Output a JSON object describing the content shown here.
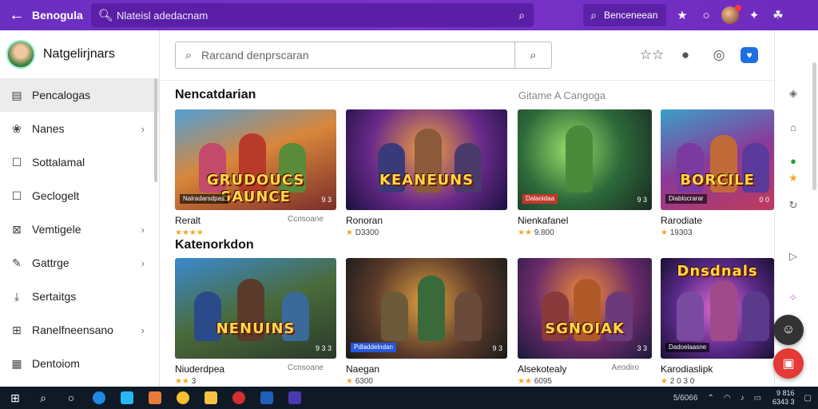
{
  "topbar": {
    "title": "Benogula",
    "search_text": "Nlateisl adedacnam",
    "pill_label": "Benceneean",
    "icons": [
      "back-arrow-icon",
      "search-icon",
      "star-icon",
      "shield-icon",
      "avatar",
      "settings-icon",
      "network-icon"
    ]
  },
  "sidebar": {
    "profile_name": "Natgelirjnars",
    "items": [
      {
        "label": "Pencalogas",
        "icon": "library-icon",
        "active": true
      },
      {
        "label": "Nanes",
        "icon": "tag-icon",
        "chevron": true
      },
      {
        "label": "Sottalamal",
        "icon": "square-icon"
      },
      {
        "label": "Geclogelt",
        "icon": "square-icon"
      },
      {
        "label": "Vemtigele",
        "icon": "image-icon",
        "chevron": true
      },
      {
        "label": "Gattrge",
        "icon": "edit-icon",
        "chevron": true
      },
      {
        "label": "Sertaitgs",
        "icon": "upload-icon"
      },
      {
        "label": "Ranelfneensano",
        "icon": "grid-icon",
        "chevron": true
      },
      {
        "label": "Dentoiom",
        "icon": "calendar-icon"
      }
    ]
  },
  "main": {
    "search_placeholder": "Rarcand denprscaran",
    "section1_title": "Nencatdarian",
    "section1_right": "Gitame A Cangoga",
    "section2_title": "Katenorkdon",
    "row1": [
      {
        "name": "Reralt",
        "meta": "Ccnsoane",
        "rating": "★★★★",
        "rating_text": "",
        "logo": "GRUDOUCS SAUNCE",
        "badge": "Nalradarsdpas",
        "size": "9 3"
      },
      {
        "name": "Ronoran",
        "meta": "",
        "rating": "★",
        "rating_text": "D3300",
        "logo": "KEANEUNS",
        "badge": "",
        "size": ""
      },
      {
        "name": "Nienkafanel",
        "meta": "",
        "rating": "★★",
        "rating_text": "9.800",
        "logo": "",
        "badge": "Dalaoidaa",
        "size": "9 3"
      },
      {
        "name": "Rarodiate",
        "meta": "",
        "rating": "★",
        "rating_text": "19303",
        "logo": "BORCILE",
        "badge": "Diablocrarar",
        "size": "0 0"
      }
    ],
    "row2": [
      {
        "name": "Niuderdpea",
        "meta": "Ccnsoane",
        "rating": "★★",
        "rating_text": "3",
        "logo": "NENUINS",
        "badge": "",
        "size": "9 3 3"
      },
      {
        "name": "Naegan",
        "meta": "",
        "rating": "★",
        "rating_text": "6300",
        "logo": "",
        "badge": "Pdladdelndan",
        "size": "9 3"
      },
      {
        "name": "Alsekotealy",
        "meta": "Aeodiro",
        "rating": "★★",
        "rating_text": "6095",
        "logo": "SGNOIAK",
        "badge": "",
        "size": "3 3"
      },
      {
        "name": "Karodiaslipk",
        "meta": "",
        "rating": "★",
        "rating_text": "2 0 3 0",
        "logo": "Dnsdnals",
        "badge": "Dadoelaasne",
        "size": ""
      }
    ]
  },
  "taskbar": {
    "tray_text_1": "5/6066",
    "clock_line_1": "9 816",
    "clock_line_2": "6343 3"
  },
  "colors": {
    "topbar": "#6a2ec0",
    "accent_star": "#f5a623",
    "badge_blue": "#2857d8",
    "fab_red": "#e53935",
    "fab_dark": "#333333"
  }
}
